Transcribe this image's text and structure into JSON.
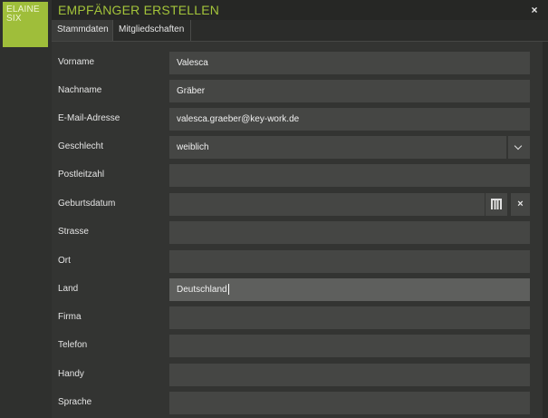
{
  "brand": {
    "line1": "ELAINE",
    "line2": "SIX",
    "color": "#9fbe3a"
  },
  "dialog": {
    "title": "EMPFÄNGER ERSTELLEN",
    "close_label": "×",
    "title_color": "#a3c33a"
  },
  "tabs": [
    {
      "label": "Stammdaten",
      "active": true
    },
    {
      "label": "Mitgliedschaften",
      "active": false
    }
  ],
  "form": {
    "vorname": {
      "label": "Vorname",
      "value": "Valesca"
    },
    "nachname": {
      "label": "Nachname",
      "value": "Gräber"
    },
    "email": {
      "label": "E-Mail-Adresse",
      "value": "valesca.graeber@key-work.de"
    },
    "geschlecht": {
      "label": "Geschlecht",
      "value": "weiblich"
    },
    "plz": {
      "label": "Postleitzahl",
      "value": ""
    },
    "geburtsdatum": {
      "label": "Geburtsdatum",
      "value": ""
    },
    "strasse": {
      "label": "Strasse",
      "value": ""
    },
    "ort": {
      "label": "Ort",
      "value": ""
    },
    "land": {
      "label": "Land",
      "value": "Deutschland"
    },
    "firma": {
      "label": "Firma",
      "value": ""
    },
    "telefon": {
      "label": "Telefon",
      "value": ""
    },
    "handy": {
      "label": "Handy",
      "value": ""
    },
    "sprache": {
      "label": "Sprache",
      "value": ""
    }
  },
  "icons": {
    "select": "chevron-down-icon",
    "date": "calendar-icon",
    "clear": "close-icon"
  },
  "clear_label": "×"
}
